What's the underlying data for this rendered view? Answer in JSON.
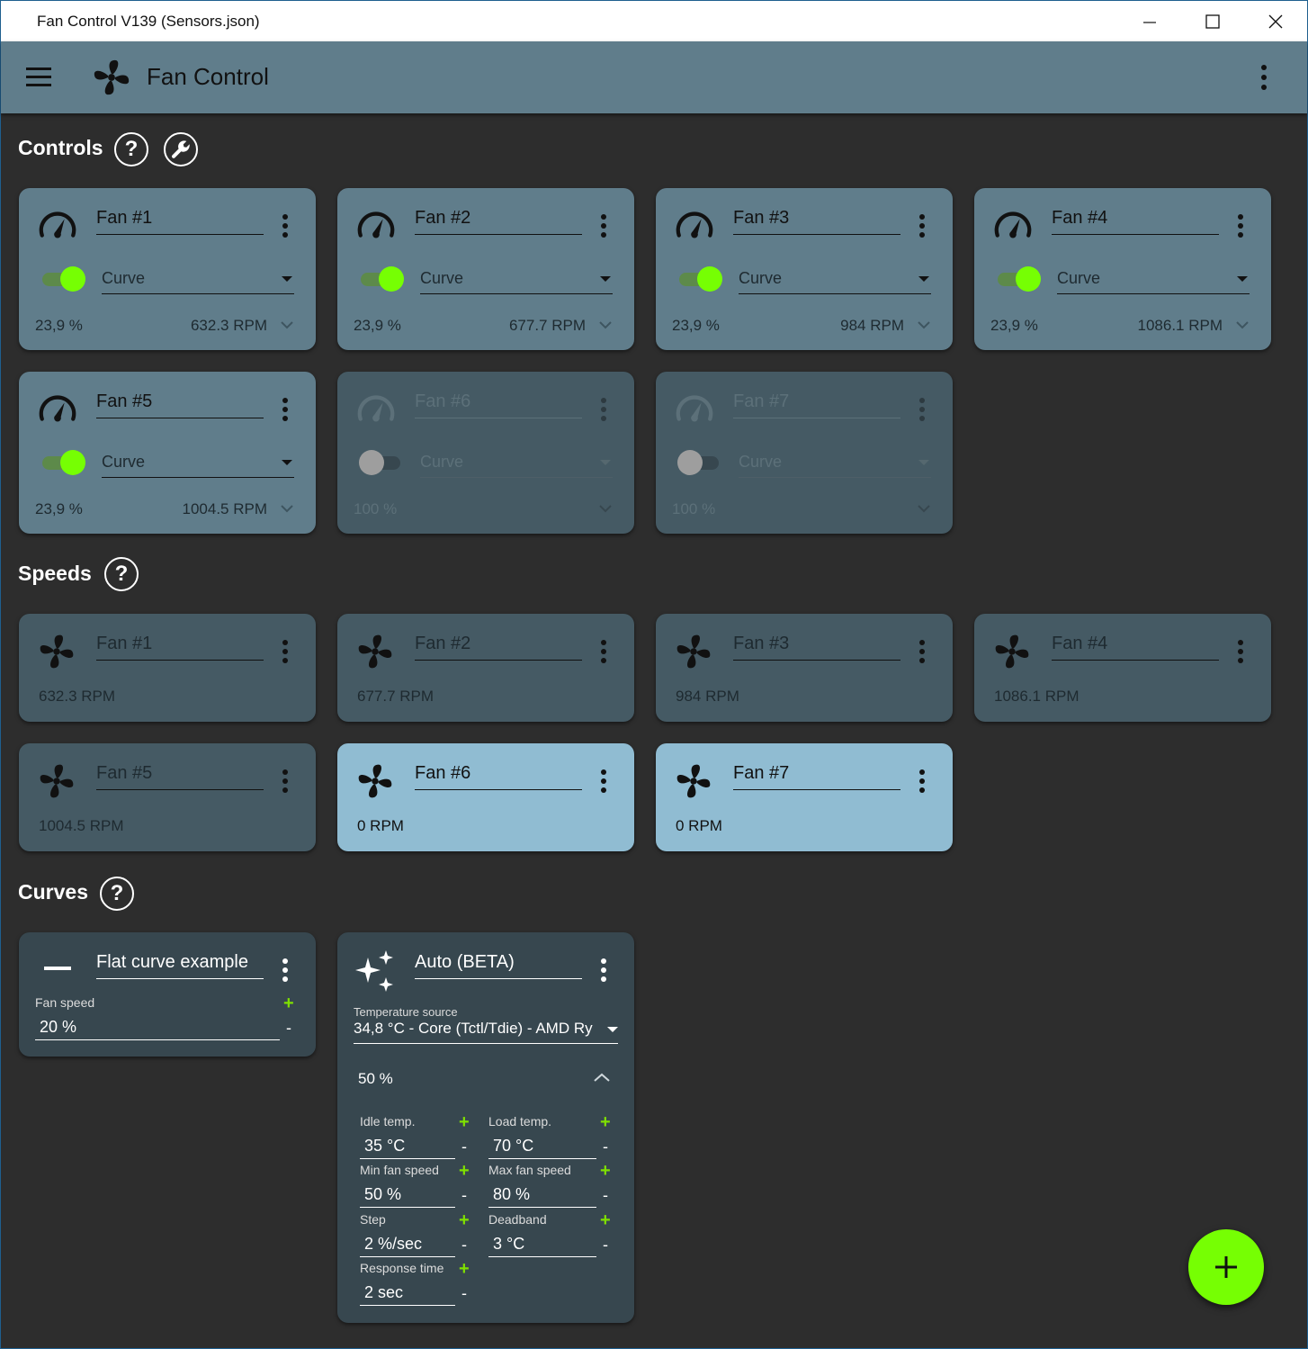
{
  "window": {
    "title": "Fan Control V139 (Sensors.json)"
  },
  "appbar": {
    "title": "Fan Control"
  },
  "sections": {
    "controls": "Controls",
    "speeds": "Speeds",
    "curves": "Curves",
    "help": "?"
  },
  "controls": [
    {
      "name": "Fan #1",
      "mode": "Curve",
      "percent": "23,9 %",
      "rpm": "632.3 RPM",
      "enabled": true
    },
    {
      "name": "Fan #2",
      "mode": "Curve",
      "percent": "23,9 %",
      "rpm": "677.7 RPM",
      "enabled": true
    },
    {
      "name": "Fan #3",
      "mode": "Curve",
      "percent": "23,9 %",
      "rpm": "984 RPM",
      "enabled": true
    },
    {
      "name": "Fan #4",
      "mode": "Curve",
      "percent": "23,9 %",
      "rpm": "1086.1 RPM",
      "enabled": true
    },
    {
      "name": "Fan #5",
      "mode": "Curve",
      "percent": "23,9 %",
      "rpm": "1004.5 RPM",
      "enabled": true
    },
    {
      "name": "Fan #6",
      "mode": "Curve",
      "percent": "100 %",
      "rpm": "",
      "enabled": false
    },
    {
      "name": "Fan #7",
      "mode": "Curve",
      "percent": "100 %",
      "rpm": "",
      "enabled": false
    }
  ],
  "speeds": [
    {
      "name": "Fan #1",
      "rpm": "632.3 RPM"
    },
    {
      "name": "Fan #2",
      "rpm": "677.7 RPM"
    },
    {
      "name": "Fan #3",
      "rpm": "984 RPM"
    },
    {
      "name": "Fan #4",
      "rpm": "1086.1 RPM"
    },
    {
      "name": "Fan #5",
      "rpm": "1004.5 RPM"
    },
    {
      "name": "Fan #6",
      "rpm": "0 RPM"
    },
    {
      "name": "Fan #7",
      "rpm": "0 RPM"
    }
  ],
  "curves": {
    "flat": {
      "name": "Flat curve example",
      "fan_speed_label": "Fan speed",
      "fan_speed_value": "20 %"
    },
    "auto": {
      "name": "Auto (BETA)",
      "temp_source_label": "Temperature source",
      "temp_source_value": "34,8 °C - Core (Tctl/Tdie) - AMD Ry",
      "output": "50 %",
      "idle_temp_label": "Idle temp.",
      "idle_temp_value": "35 °C",
      "load_temp_label": "Load temp.",
      "load_temp_value": "70 °C",
      "min_speed_label": "Min fan speed",
      "min_speed_value": "50 %",
      "max_speed_label": "Max fan speed",
      "max_speed_value": "80 %",
      "step_label": "Step",
      "step_value": "2 %/sec",
      "deadband_label": "Deadband",
      "deadband_value": "3 °C",
      "response_label": "Response time",
      "response_value": "2 sec"
    }
  },
  "symbols": {
    "plus": "+",
    "minus": "-"
  },
  "colors": {
    "accent": "#76ff03",
    "appbar": "#607d8b",
    "card_active": "#607d8b",
    "card_dim": "#455a64",
    "card_highlight": "#90bcd2",
    "curve_card": "#37474f",
    "background": "#2d2d2d"
  },
  "icons": {
    "control_card": "speedometer-icon",
    "speed_card": "fan-icon",
    "flat_curve": "minus-icon",
    "auto_curve": "sparkle-icon",
    "fab": "plus-icon"
  }
}
